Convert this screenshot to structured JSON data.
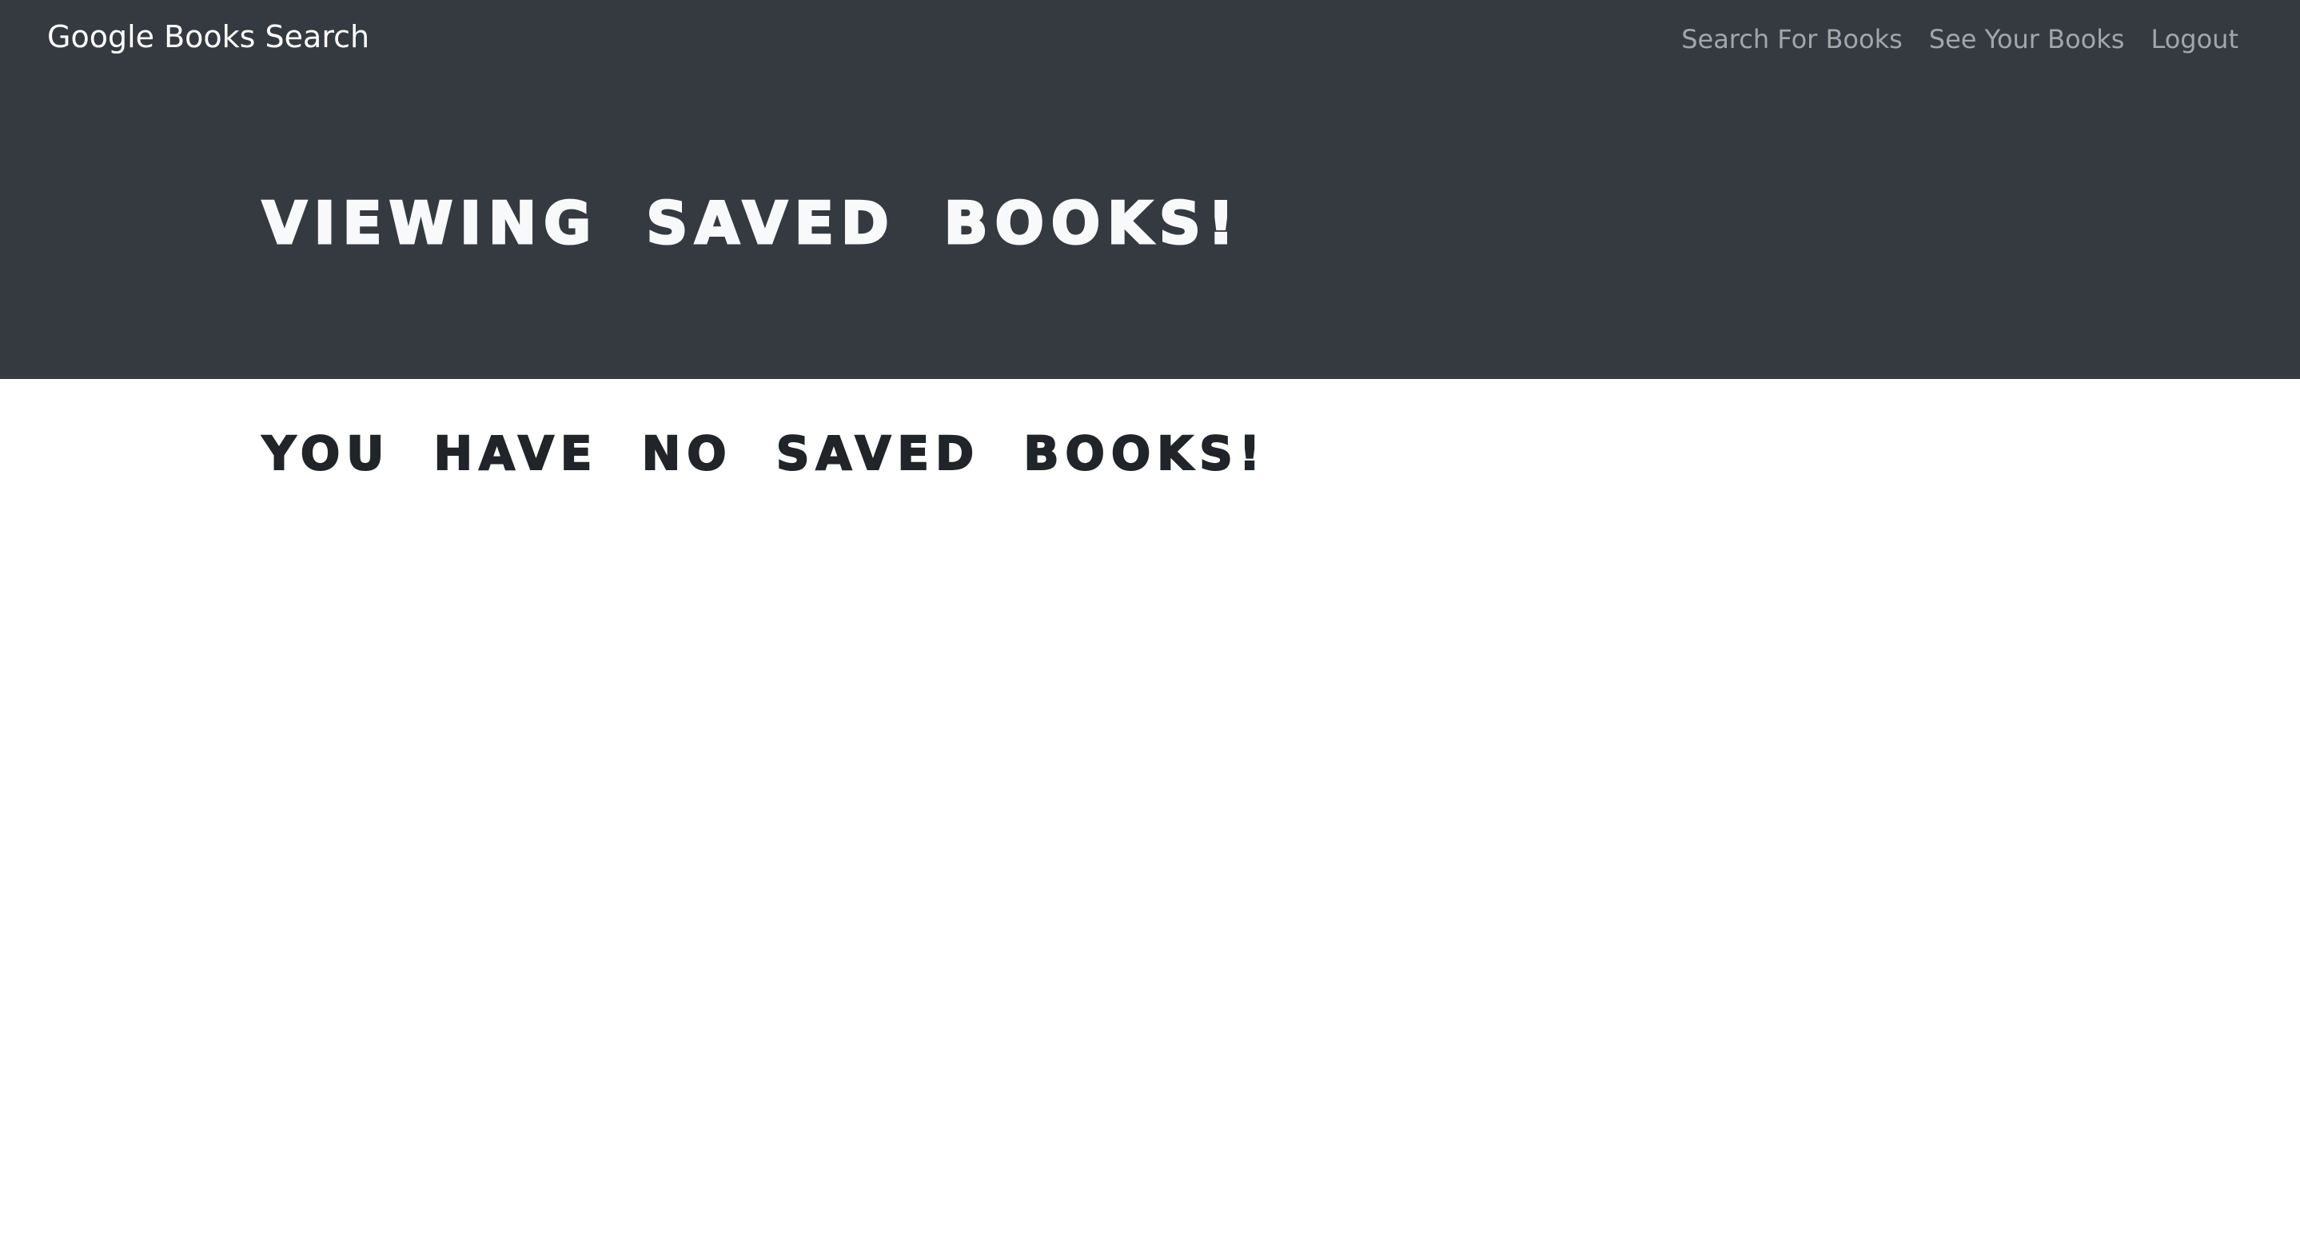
{
  "navbar": {
    "brand": "Google Books Search",
    "links": [
      {
        "label": "Search For Books"
      },
      {
        "label": "See Your Books"
      },
      {
        "label": "Logout"
      }
    ]
  },
  "hero": {
    "title": "VIEWING SAVED BOOKS!"
  },
  "main": {
    "empty_message": "YOU HAVE NO SAVED BOOKS!"
  },
  "colors": {
    "navbar_bg": "#343a40",
    "hero_text": "#f8f9fa",
    "body_text": "#212529",
    "nav_link": "rgba(255,255,255,0.55)"
  }
}
